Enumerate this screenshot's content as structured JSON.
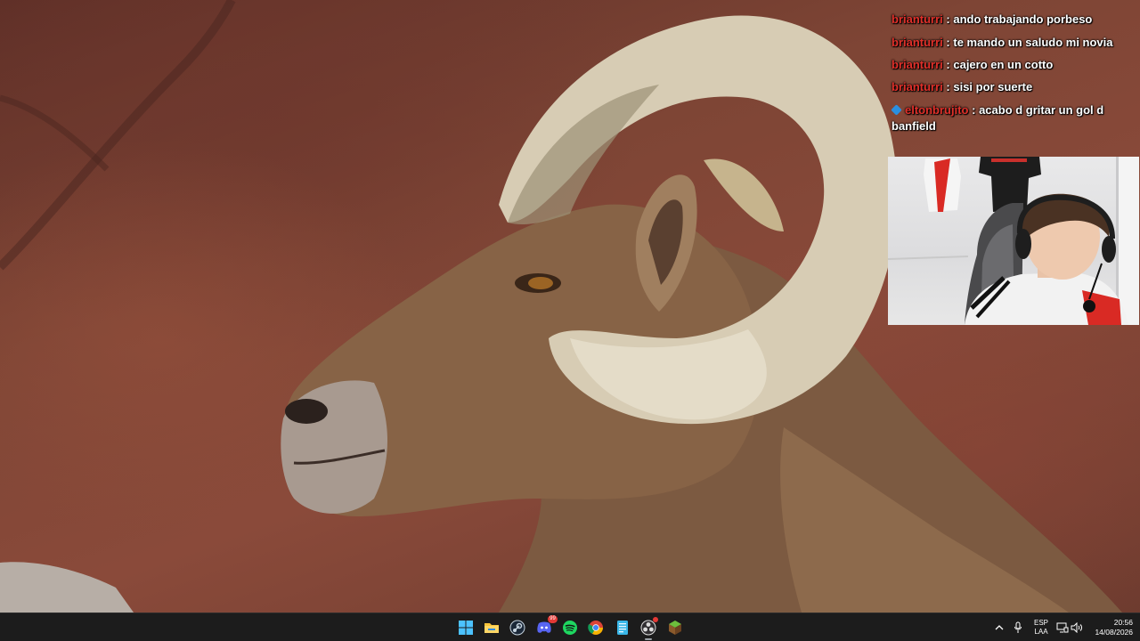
{
  "chat": {
    "messages": [
      {
        "user": "brianturri",
        "text": ": ando trabajando porbeso"
      },
      {
        "user": "brianturri",
        "text": ": te mando un saludo mi novia"
      },
      {
        "user": "brianturri",
        "text": ": cajero en un cotto"
      },
      {
        "user": "brianturri",
        "text": ": sisi por suerte"
      },
      {
        "user": "eltonbrujito",
        "text": ": acabo d gritar un gol d banfield",
        "badge": "cube-badge-icon"
      }
    ]
  },
  "taskbar": {
    "icons": [
      {
        "name": "windows-start-icon"
      },
      {
        "name": "file-explorer-icon"
      },
      {
        "name": "steam-icon"
      },
      {
        "name": "discord-icon",
        "badge": "99"
      },
      {
        "name": "spotify-icon"
      },
      {
        "name": "chrome-icon"
      },
      {
        "name": "notepad-icon"
      },
      {
        "name": "obs-icon"
      },
      {
        "name": "minecraft-icon"
      }
    ],
    "tray": {
      "language_line1": "ESP",
      "language_line2": "LAA",
      "time": "20:56",
      "date": "14/08/2026"
    }
  },
  "colors": {
    "taskbar_bg": "#1c1c1c",
    "chat_user": "#e0302a",
    "chat_text": "#ffffff"
  }
}
